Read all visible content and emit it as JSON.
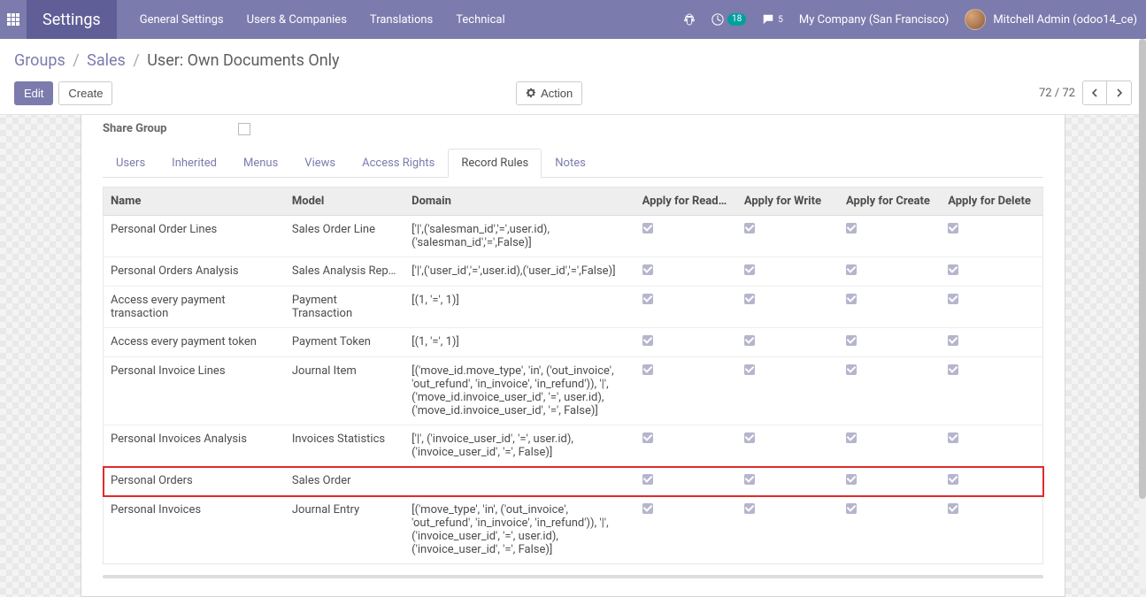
{
  "brand": "Settings",
  "nav": {
    "items": [
      "General Settings",
      "Users & Companies",
      "Translations",
      "Technical"
    ]
  },
  "systray": {
    "activity_count": "18",
    "msg_count": "5",
    "company": "My Company (San Francisco)",
    "user": "Mitchell Admin (odoo14_ce)"
  },
  "breadcrumb": {
    "a": "Groups",
    "b": "Sales",
    "c": "User: Own Documents Only"
  },
  "buttons": {
    "edit": "Edit",
    "create": "Create",
    "action": "Action"
  },
  "pager": {
    "value": "72 / 72"
  },
  "share_group_label": "Share Group",
  "tabs": [
    "Users",
    "Inherited",
    "Menus",
    "Views",
    "Access Rights",
    "Record Rules",
    "Notes"
  ],
  "active_tab_index": 5,
  "columns": [
    "Name",
    "Model",
    "Domain",
    "Apply for Read…",
    "Apply for Write",
    "Apply for Create",
    "Apply for Delete"
  ],
  "rows": [
    {
      "name": "Personal Order Lines",
      "model": "Sales Order Line",
      "domain": "['|',('salesman_id','=',user.id),('salesman_id','=',False)]",
      "r": true,
      "w": true,
      "c": true,
      "d": true
    },
    {
      "name": "Personal Orders Analysis",
      "model": "Sales Analysis Rep…",
      "domain": "['|',('user_id','=',user.id),('user_id','=',False)]",
      "r": true,
      "w": true,
      "c": true,
      "d": true
    },
    {
      "name": "Access every payment transaction",
      "model": "Payment Transaction",
      "domain": "[(1, '=', 1)]",
      "r": true,
      "w": true,
      "c": true,
      "d": true
    },
    {
      "name": "Access every payment token",
      "model": "Payment Token",
      "domain": "[(1, '=', 1)]",
      "r": true,
      "w": true,
      "c": true,
      "d": true
    },
    {
      "name": "Personal Invoice Lines",
      "model": "Journal Item",
      "domain": "[('move_id.move_type', 'in', ('out_invoice', 'out_refund', 'in_invoice', 'in_refund')), '|', ('move_id.invoice_user_id', '=', user.id), ('move_id.invoice_user_id', '=', False)]",
      "r": true,
      "w": true,
      "c": true,
      "d": true
    },
    {
      "name": "Personal Invoices Analysis",
      "model": "Invoices Statistics",
      "domain": "['|', ('invoice_user_id', '=', user.id), ('invoice_user_id', '=', False)]",
      "r": true,
      "w": true,
      "c": true,
      "d": true
    },
    {
      "name": "Personal Orders",
      "model": "Sales Order",
      "domain": "",
      "r": true,
      "w": true,
      "c": true,
      "d": true,
      "highlight": true
    },
    {
      "name": "Personal Invoices",
      "model": "Journal Entry",
      "domain": "[('move_type', 'in', ('out_invoice', 'out_refund', 'in_invoice', 'in_refund')), '|', ('invoice_user_id', '=', user.id), ('invoice_user_id', '=', False)]",
      "r": true,
      "w": true,
      "c": true,
      "d": true
    }
  ]
}
